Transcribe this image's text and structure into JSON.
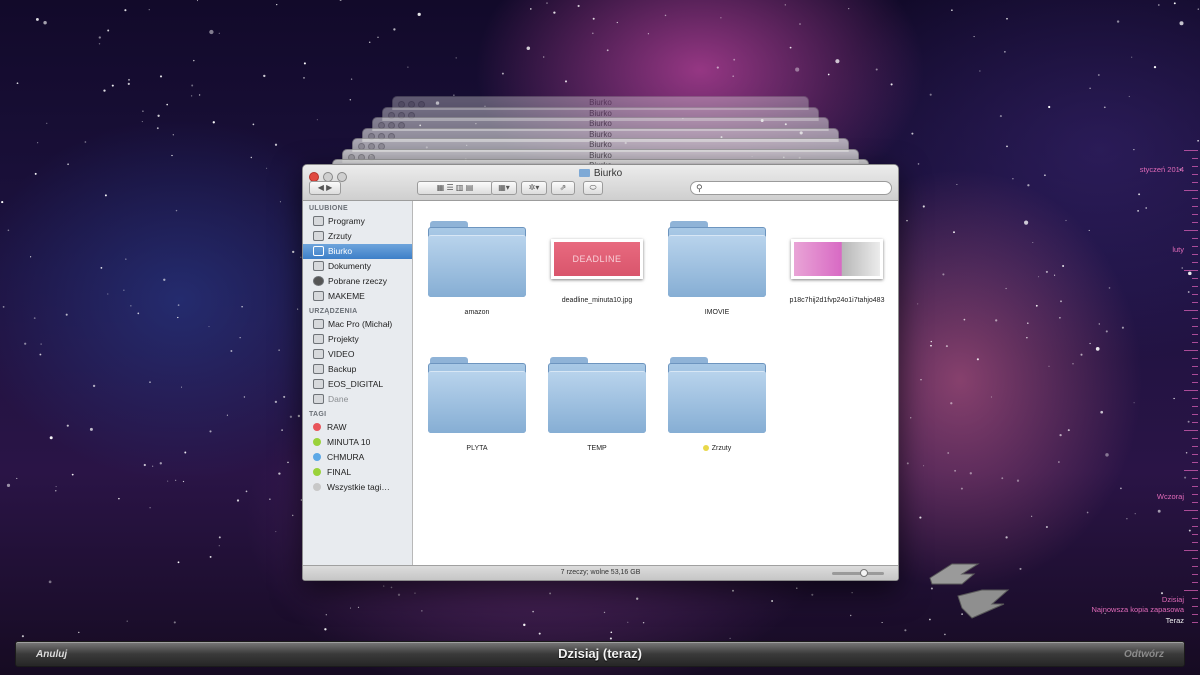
{
  "window": {
    "title": "Biurko",
    "stack_title": "Biurko",
    "search_placeholder": "",
    "status": "7 rzeczy; wolne 53,16 GB"
  },
  "sidebar": {
    "favorites_heading": "ULUBIONE",
    "favorites": [
      {
        "label": "Programy",
        "icon": "apps-icon"
      },
      {
        "label": "Zrzuty",
        "icon": "folder-icon"
      },
      {
        "label": "Biurko",
        "icon": "desktop-icon",
        "active": true
      },
      {
        "label": "Dokumenty",
        "icon": "document-icon"
      },
      {
        "label": "Pobrane rzeczy",
        "icon": "download-icon"
      },
      {
        "label": "MAKEME",
        "icon": "folder-icon"
      }
    ],
    "devices_heading": "URZĄDZENIA",
    "devices": [
      {
        "label": "Mac Pro (Michał)",
        "icon": "computer-icon"
      },
      {
        "label": "Projekty",
        "icon": "drive-icon"
      },
      {
        "label": "VIDEO",
        "icon": "drive-icon"
      },
      {
        "label": "Backup",
        "icon": "drive-icon"
      },
      {
        "label": "EOS_DIGITAL",
        "icon": "drive-icon"
      },
      {
        "label": "Dane",
        "icon": "drive-icon",
        "dim": true
      }
    ],
    "tags_heading": "TAGI",
    "tags": [
      {
        "label": "RAW",
        "color": "#e8545a"
      },
      {
        "label": "MINUTA 10",
        "color": "#9ad23a"
      },
      {
        "label": "CHMURA",
        "color": "#5ca8e6"
      },
      {
        "label": "FINAL",
        "color": "#9ad23a"
      },
      {
        "label": "Wszystkie tagi…",
        "color": "#c8c8c8"
      }
    ]
  },
  "files": [
    {
      "name": "amazon",
      "type": "folder"
    },
    {
      "name": "deadline_minuta10.jpg",
      "type": "image",
      "thumb_text": "DEADLINE"
    },
    {
      "name": "IMOVIE",
      "type": "folder"
    },
    {
      "name": "p18c7hij2d1fvp24o1i7tahjo483",
      "type": "image"
    },
    {
      "name": "PLYTA",
      "type": "folder"
    },
    {
      "name": "TEMP",
      "type": "folder"
    },
    {
      "name": "Zrzuty",
      "type": "folder",
      "tag_color": "#e9d84a"
    }
  ],
  "timeline": {
    "labels": [
      "styczeń 2014",
      "luty",
      "Wczoraj",
      "Dzisiaj",
      "Najnowsza kopia zapasowa",
      "Teraz"
    ]
  },
  "bottom_bar": {
    "cancel": "Anuluj",
    "title": "Dzisiaj (teraz)",
    "restore": "Odtwórz"
  },
  "colors": {
    "selection": "#3d7fc8",
    "timeline": "#e06ab8"
  }
}
